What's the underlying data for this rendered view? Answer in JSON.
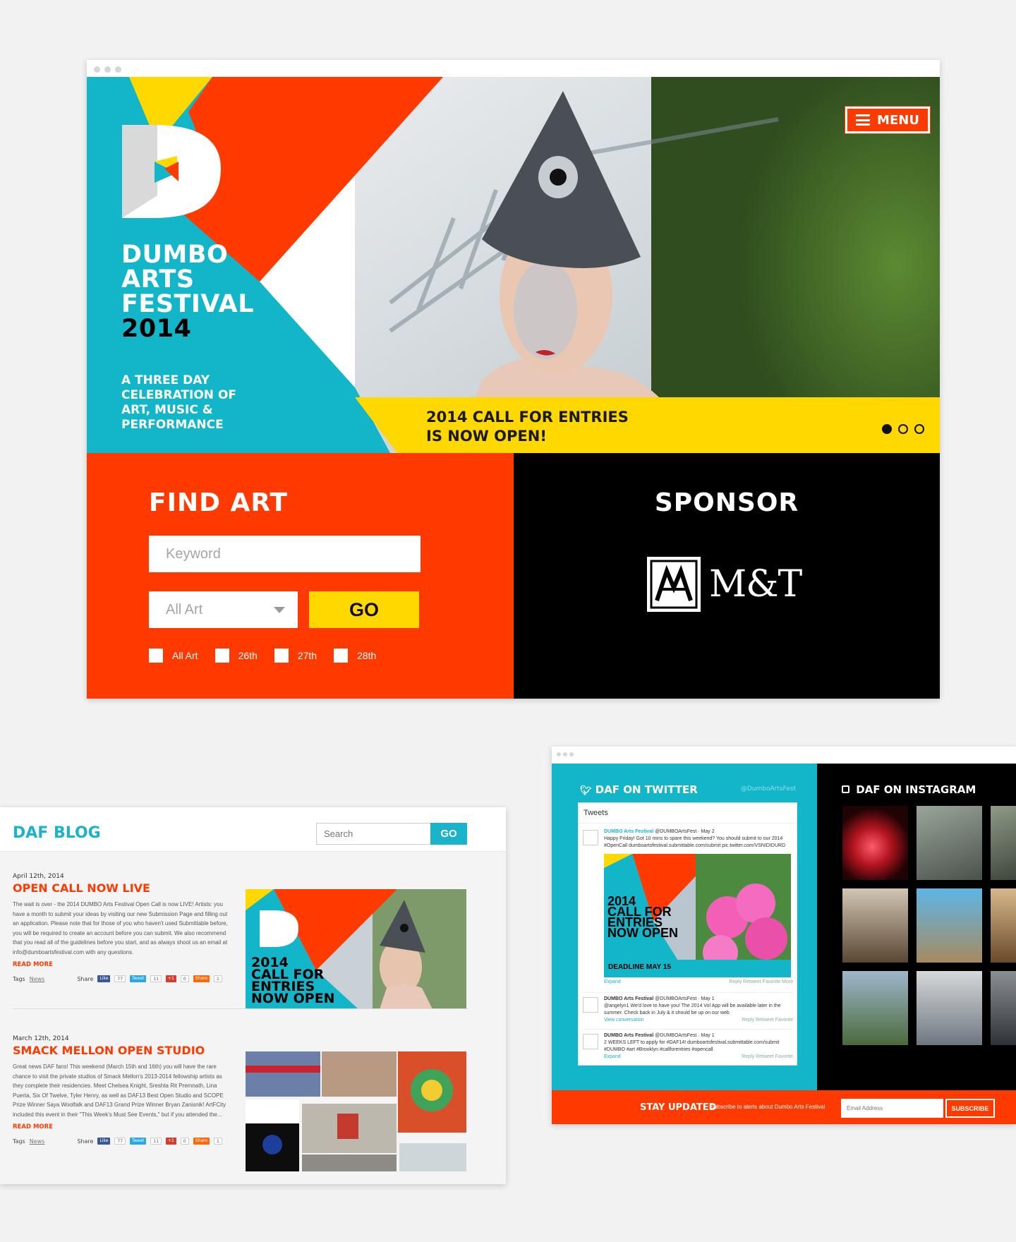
{
  "hero": {
    "logo_lines": [
      "DUMBO",
      "ARTS",
      "FESTIVAL"
    ],
    "logo_year": "2014",
    "tagline_lines": [
      "A THREE DAY",
      "CELEBRATION OF",
      "ART, MUSIC &",
      "PERFORMANCE"
    ],
    "menu_label": "MENU",
    "callout_lines": [
      "2014 CALL FOR ENTRIES",
      "IS NOW OPEN!"
    ],
    "slides": 3,
    "active_slide": 1
  },
  "find_art": {
    "title": "FIND ART",
    "keyword_placeholder": "Keyword",
    "category_selected": "All Art",
    "go_label": "GO",
    "checkboxes": [
      "All Art",
      "26th",
      "27th",
      "28th"
    ]
  },
  "sponsor": {
    "title": "SPONSOR",
    "name": "M&T"
  },
  "blog": {
    "title": "DAF BLOG",
    "search_placeholder": "Search",
    "go_label": "GO",
    "posts": [
      {
        "date": "April 12th, 2014",
        "title": "OPEN CALL NOW LIVE",
        "excerpt": "The wait is over - the 2014 DUMBO Arts Festival Open Call is now LIVE! Artists: you have a month to submit your ideas by visiting our new Submission Page and filling out an application. Please note that for those of you who haven't used Submittable before, you will be required to create an account before you can submit. We also recommend that you read all of the guidelines before you start, and as always shoot us an email at info@dumboartsfestival.com with any questions.",
        "read_more": "READ MORE",
        "tags_label": "Tags",
        "tag": "News",
        "share_label": "Share",
        "image_text_lines": [
          "2014",
          "CALL FOR",
          "ENTRIES",
          "NOW OPEN"
        ]
      },
      {
        "date": "March 12th, 2014",
        "title": "SMACK MELLON OPEN STUDIO",
        "excerpt": "Great news DAF fans! This weekend (March 15th and 16th) you will have the rare chance to visit the private studios of Smack Mellon's 2013-2014 fellowship artists as they complete their residencies. Meet Chelsea Knight, Sreshta Rit Premnath, Lina Puerta, Six Of Twelve, Tyler Henry, as well as DAF13 Best Open Studio and SCOPE Prize Winner Saya Woolfalk and DAF13 Grand Prize Winner Bryan Zanisnik! ArtFCity included this event in their \"This Week's Must See Events,\" but if you attended the...",
        "read_more": "READ MORE",
        "tags_label": "Tags",
        "tag": "News",
        "share_label": "Share"
      }
    ],
    "share_buttons": {
      "like": "Like",
      "like_count": "77",
      "tweet": "Tweet",
      "tweet_count": "11",
      "gplus": "+1",
      "gplus_count": "0",
      "share": "Share",
      "share_count": "1"
    }
  },
  "twitter": {
    "title": "DAF ON TWITTER",
    "handle": "@DumboArtsFest",
    "panel_header": "Tweets",
    "tweets": [
      {
        "name": "DUMBO Arts Festival",
        "meta": "@DUMBOArtsFest · May 2",
        "text": "Happy Friday! Got 10 mins to spare this weekend? You should submit to our 2014 #OpenCall dumboartsfestival.submittable.com/submit pic.twitter.com/VSNIDIDURD",
        "image_lines": [
          "2014",
          "CALL FOR",
          "ENTRIES",
          "NOW OPEN"
        ],
        "image_deadline": "DEADLINE MAY 15",
        "expand": "Expand",
        "actions": "Reply  Retweet  Favorite  More"
      },
      {
        "name": "DUMBO Arts Festival",
        "meta": "@DUMBOArtsFest · May 1",
        "text": "@angelyn1 We'd love to have you! The 2014 Vol App will be available later in the summer. Check back in July & it should be up on our web",
        "expand": "View conversation",
        "actions": "Reply  Retweet  Favorite"
      },
      {
        "name": "DUMBO Arts Festival",
        "meta": "@DUMBOArtsFest · May 1",
        "text": "2 WEEKS LEFT to apply for #DAF14! dumboartsfestival.submittable.com/submit #DUMBO #art #Brooklyn #callforentries #opencall",
        "expand": "Expand",
        "actions": "Reply  Retweet  Favorite"
      }
    ]
  },
  "instagram": {
    "title": "DAF ON INSTAGRAM"
  },
  "stay_updated": {
    "label": "STAY UPDATED",
    "subtext": "Subscribe to alerts about Dumbo Arts Festival",
    "email_placeholder": "Email Address",
    "button": "SUBSCRIBE"
  },
  "colors": {
    "orange": "#ff3a00",
    "cyan": "#13b5c8",
    "yellow": "#ffd800",
    "black": "#000000",
    "grey": "#d9d9d9"
  }
}
